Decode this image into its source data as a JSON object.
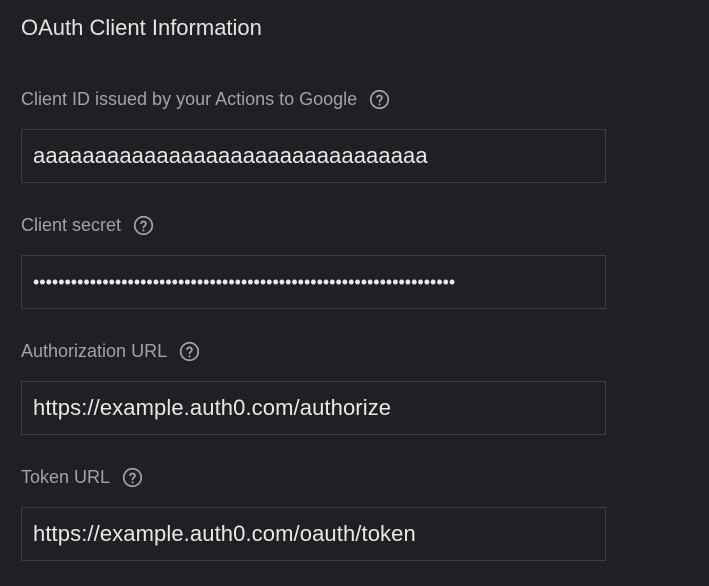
{
  "section": {
    "title": "OAuth Client Information"
  },
  "fields": [
    {
      "label": "Client ID issued by your Actions to Google",
      "value": "aaaaaaaaaaaaaaaaaaaaaaaaaaaaaaaa",
      "help_icon": "help-circle-icon"
    },
    {
      "label": "Client secret",
      "value": "•••••••••••••••••••••••••••••••••••••••••••••••••••••••••••••••••••",
      "help_icon": "help-circle-icon"
    },
    {
      "label": "Authorization URL",
      "value": "https://example.auth0.com/authorize",
      "help_icon": "help-circle-icon"
    },
    {
      "label": "Token URL",
      "value": "https://example.auth0.com/oauth/token",
      "help_icon": "help-circle-icon"
    }
  ],
  "colors": {
    "background": "#1f2023",
    "input_border": "#3d3e42",
    "label_text": "#a3a3a6",
    "value_text": "#e8e8e8",
    "title_text": "#e3e3e3"
  }
}
